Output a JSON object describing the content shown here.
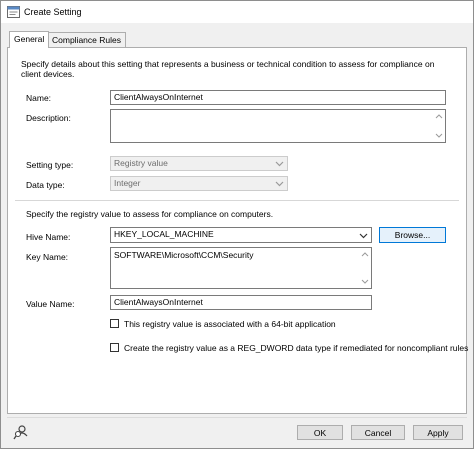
{
  "window": {
    "title": "Create Setting"
  },
  "tabs": [
    {
      "label": "General",
      "active": true
    },
    {
      "label": "Compliance Rules",
      "active": false
    }
  ],
  "general": {
    "intro": "Specify details about this setting that represents a business or technical condition to assess for compliance on client devices.",
    "name_label": "Name:",
    "name_value": "ClientAlwaysOnInternet",
    "description_label": "Description:",
    "description_value": "",
    "setting_type_label": "Setting type:",
    "setting_type_value": "Registry value",
    "data_type_label": "Data type:",
    "data_type_value": "Integer"
  },
  "registry": {
    "intro": "Specify the registry value to assess for compliance on computers.",
    "hive_label": "Hive Name:",
    "hive_value": "HKEY_LOCAL_MACHINE",
    "browse_label": "Browse...",
    "key_label": "Key Name:",
    "key_value": "SOFTWARE\\Microsoft\\CCM\\Security",
    "value_name_label": "Value Name:",
    "value_name_value": "ClientAlwaysOnInternet",
    "checkbox_64bit": {
      "label": "This registry value is associated with a 64-bit application",
      "checked": false
    },
    "checkbox_dword": {
      "label": "Create the registry value as a REG_DWORD data type if remediated for noncompliant rules",
      "checked": false
    }
  },
  "footer": {
    "ok_label": "OK",
    "cancel_label": "Cancel",
    "apply_label": "Apply",
    "left_icon": "user-search-icon"
  },
  "colors": {
    "focus_border": "#0078d7",
    "panel_bg": "#ffffff",
    "window_bg": "#f0f0f0"
  }
}
